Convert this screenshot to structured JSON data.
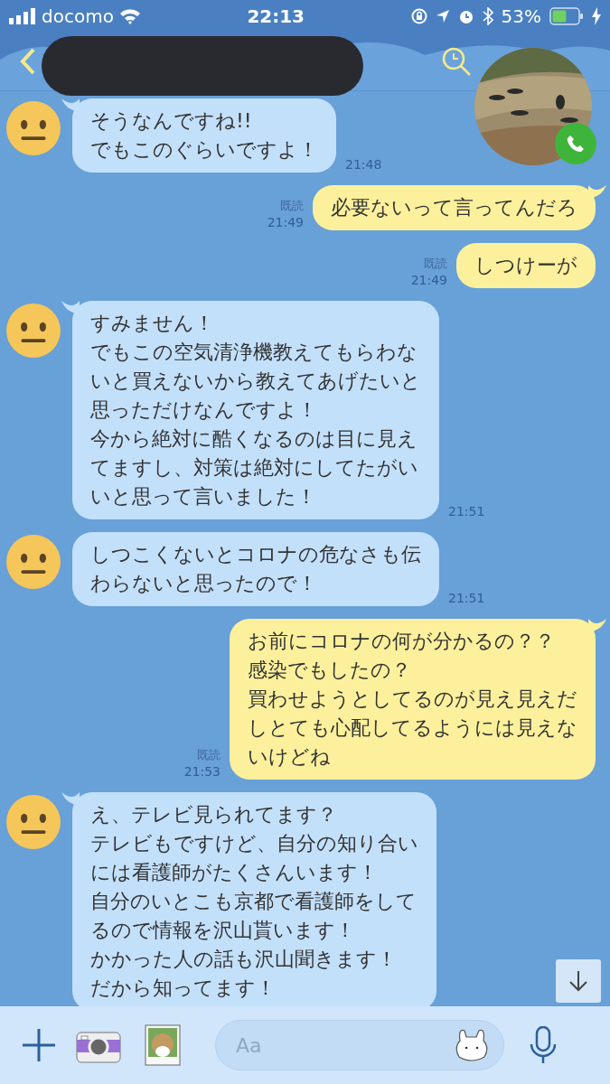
{
  "status_bar": {
    "carrier": "docomo",
    "time": "22:13",
    "battery": "53%"
  },
  "messages": [
    {
      "outgoing": false,
      "lines": [
        "そうなんですね!!",
        "でもこのぐらいですよ！"
      ],
      "time": "21:48"
    },
    {
      "outgoing": true,
      "lines": [
        "必要ないって言ってんだろ"
      ],
      "read": "既読",
      "time": "21:49"
    },
    {
      "outgoing": true,
      "lines": [
        "しつけーが"
      ],
      "read": "既読",
      "time": "21:49"
    },
    {
      "outgoing": false,
      "lines": [
        "すみません！",
        "でもこの空気清浄機教えてもらわな",
        "いと買えないから教えてあげたいと",
        "思っただけなんですよ！",
        "今から絶対に酷くなるのは目に見え",
        "てますし、対策は絶対にしてたがい",
        "いと思って言いました！"
      ],
      "time": "21:51"
    },
    {
      "outgoing": false,
      "lines": [
        "しつこくないとコロナの危なさも伝",
        "わらないと思ったので！"
      ],
      "time": "21:51"
    },
    {
      "outgoing": true,
      "lines": [
        "お前にコロナの何が分かるの？？",
        "感染でもしたの？",
        "買わせようとしてるのが見え見えだ",
        "しとても心配してるようには見えな",
        "いけどね"
      ],
      "read": "既読",
      "time": "21:53"
    },
    {
      "outgoing": false,
      "lines": [
        "え、テレビ見られてます？",
        "テレビもですけど、自分の知り合い",
        "には看護師がたくさんいます！",
        "自分のいとこも京都で看護師をして",
        "るので情報を沢山貰います！",
        "かかった人の話も沢山聞きます！",
        "だから知ってます！"
      ]
    }
  ],
  "input_bar": {
    "placeholder": "Aa"
  }
}
